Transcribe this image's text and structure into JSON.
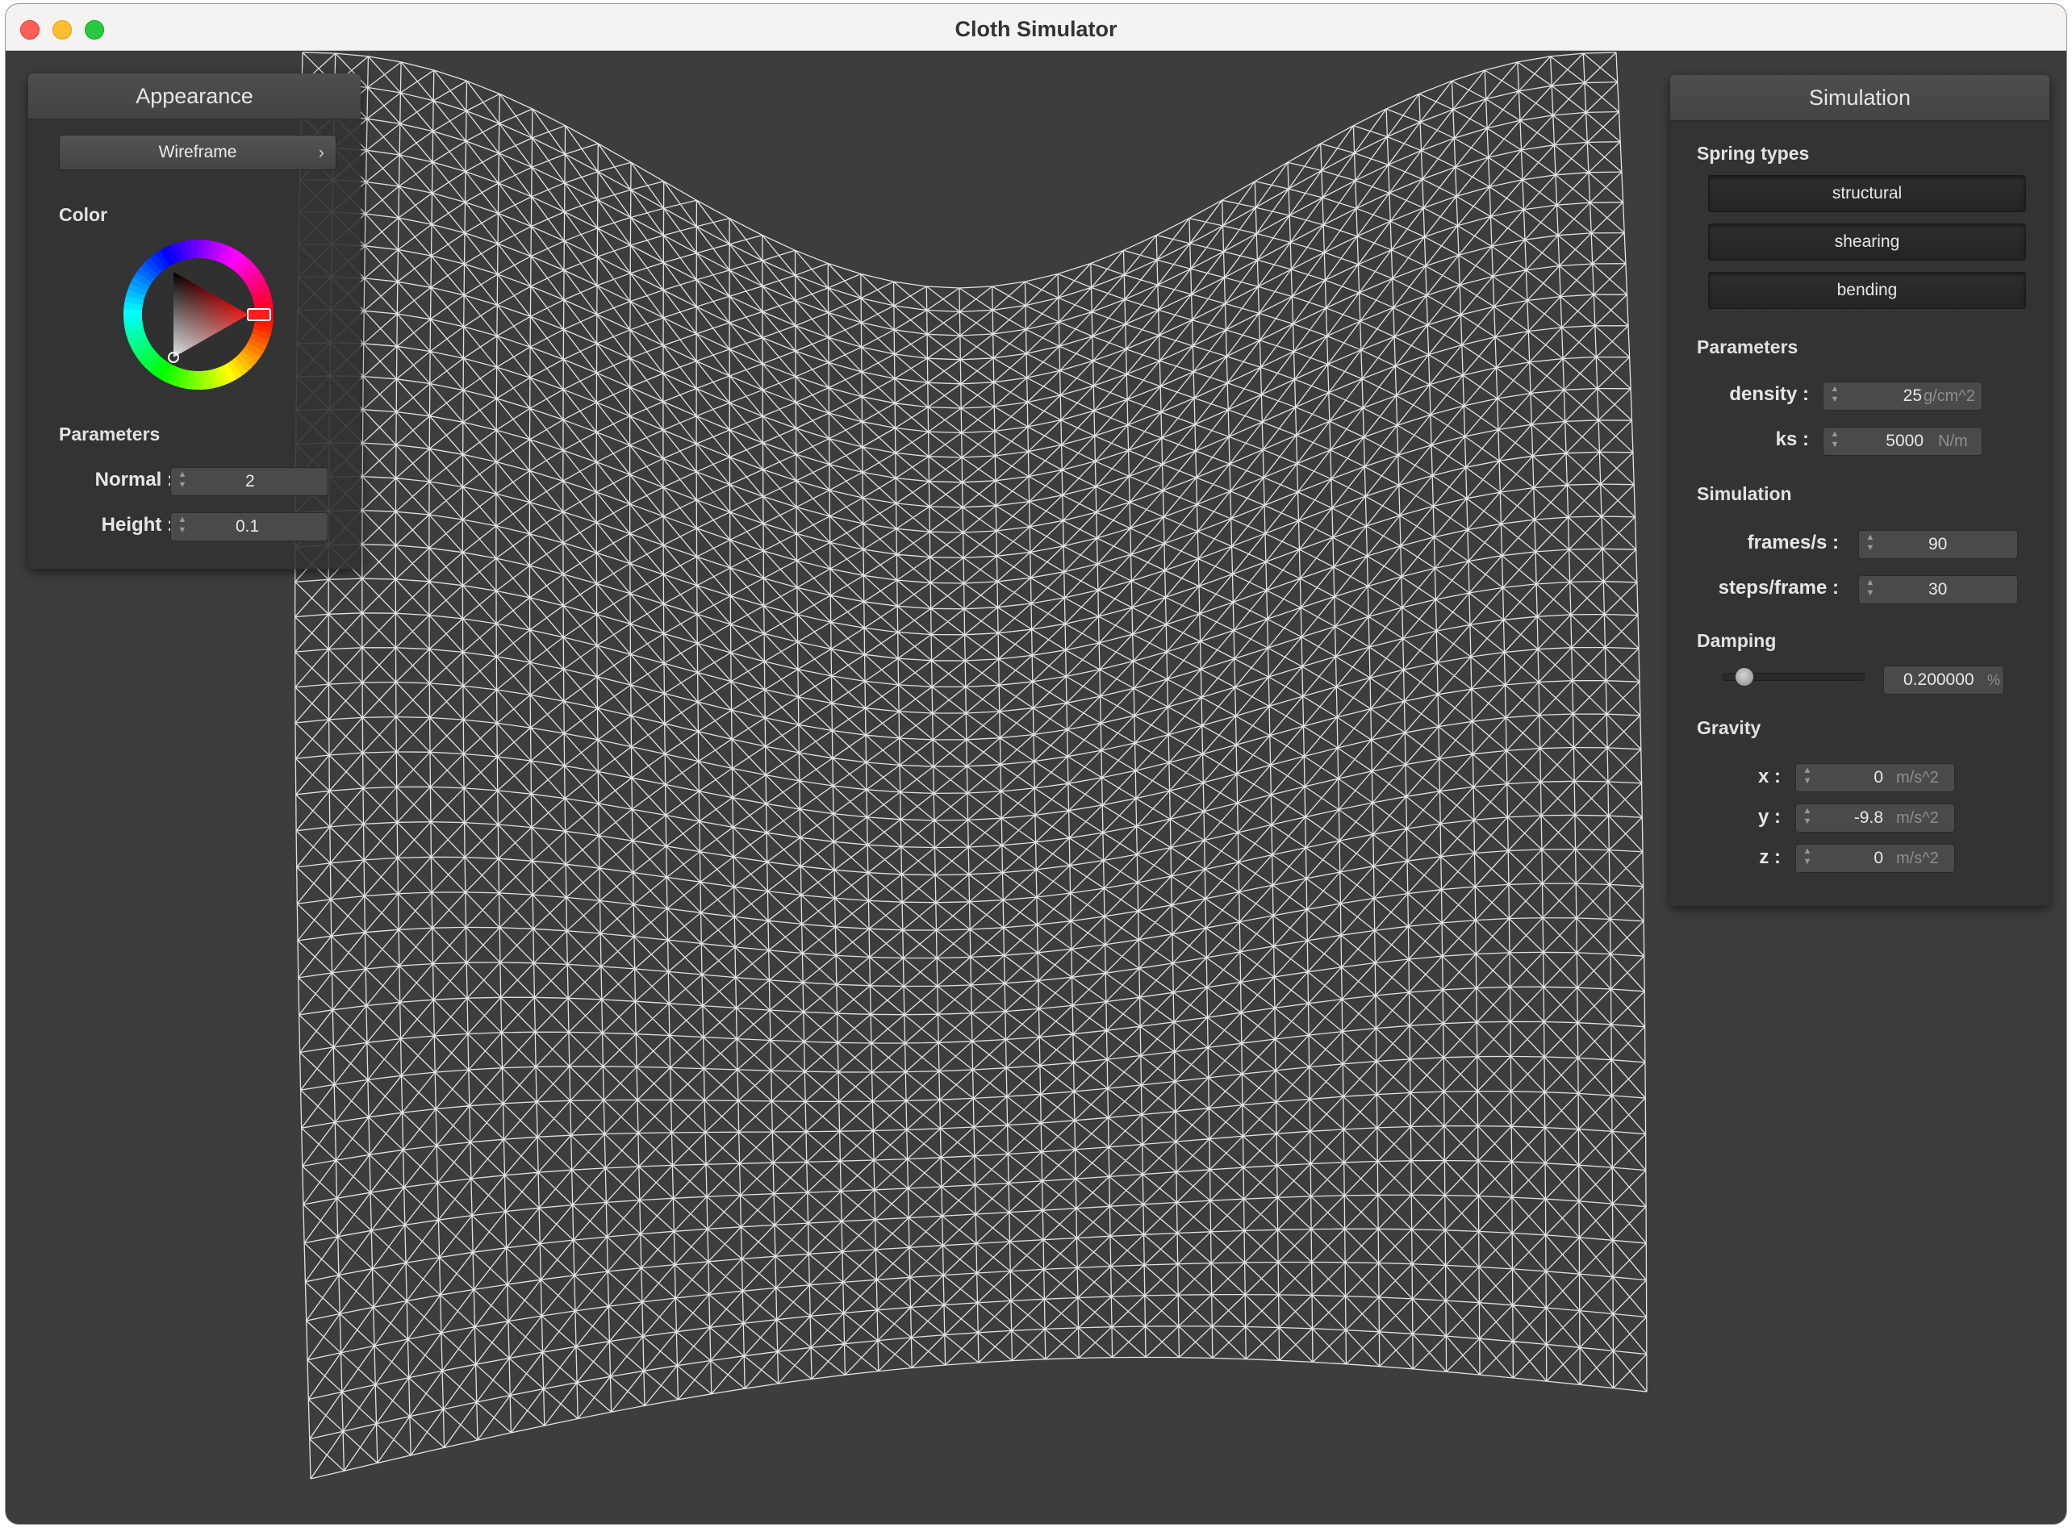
{
  "window": {
    "title": "Cloth Simulator"
  },
  "appearance": {
    "header": "Appearance",
    "shader_mode": "Wireframe",
    "shader_chevron": "›",
    "color_label": "Color",
    "parameters_label": "Parameters",
    "normal_label": "Normal :",
    "normal_value": "2",
    "height_label": "Height :",
    "height_value": "0.1",
    "selected_color": "#ff0000"
  },
  "simulation": {
    "header": "Simulation",
    "spring_types_label": "Spring types",
    "spring_types": [
      "structural",
      "shearing",
      "bending"
    ],
    "parameters_label": "Parameters",
    "density_label": "density :",
    "density_value": "25",
    "density_unit": "g/cm^2",
    "ks_label": "ks :",
    "ks_value": "5000",
    "ks_unit": "N/m",
    "sim_label": "Simulation",
    "fps_label": "frames/s :",
    "fps_value": "90",
    "steps_label": "steps/frame :",
    "steps_value": "30",
    "damping_label": "Damping",
    "damping_value": "0.200000",
    "damping_unit": "%",
    "damping_fraction": 0.2,
    "gravity_label": "Gravity",
    "gx_label": "x :",
    "gx_value": "0",
    "gy_label": "y :",
    "gy_value": "-9.8",
    "gz_label": "z :",
    "gz_value": "0",
    "g_unit": "m/s^2"
  },
  "viewport": {
    "render_mode": "wireframe cloth mesh",
    "background_color": "#3d3d3d",
    "mesh_color": "#ffffff"
  }
}
